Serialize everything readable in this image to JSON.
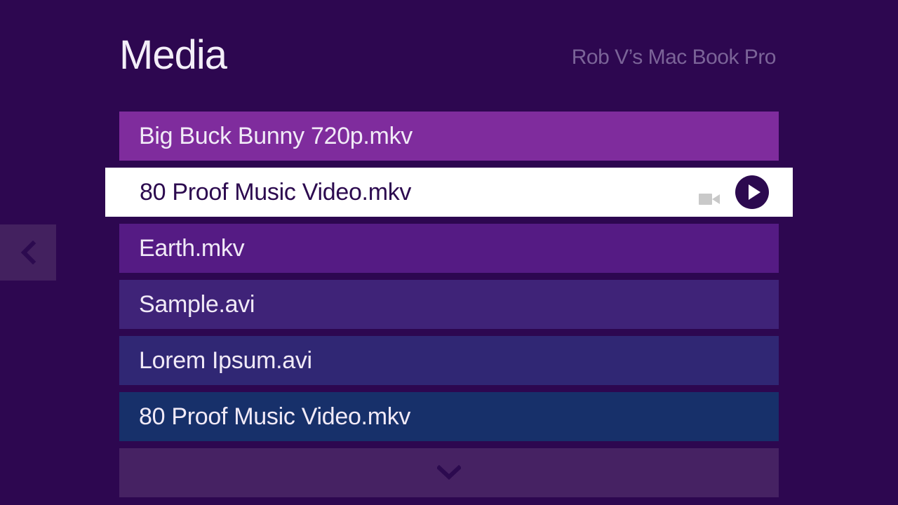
{
  "header": {
    "title": "Media",
    "device_name": "Rob V’s Mac Book Pro"
  },
  "media_items": [
    {
      "name": "Big Buck Bunny 720p.mkv",
      "color": "#7f2c9d",
      "selected": false
    },
    {
      "name": "80 Proof Music Video.mkv",
      "color": "#ffffff",
      "selected": true,
      "icons": [
        "video-camera-icon",
        "play-icon"
      ]
    },
    {
      "name": "Earth.mkv",
      "color": "#551b84",
      "selected": false
    },
    {
      "name": "Sample.avi",
      "color": "#3f2378",
      "selected": false
    },
    {
      "name": "Lorem Ipsum.avi",
      "color": "#302774",
      "selected": false
    },
    {
      "name": "80 Proof Music Video.mkv",
      "color": "#17306a",
      "selected": false
    }
  ],
  "navigation": {
    "back_icon": "chevron-left-icon",
    "more_icon": "chevron-down-icon"
  },
  "colors": {
    "background": "#2d0750",
    "selected_background": "#ffffff",
    "selected_text": "#2c0a4f",
    "chevron": "#2c0a4f",
    "device_name_text": "#7b6498"
  }
}
